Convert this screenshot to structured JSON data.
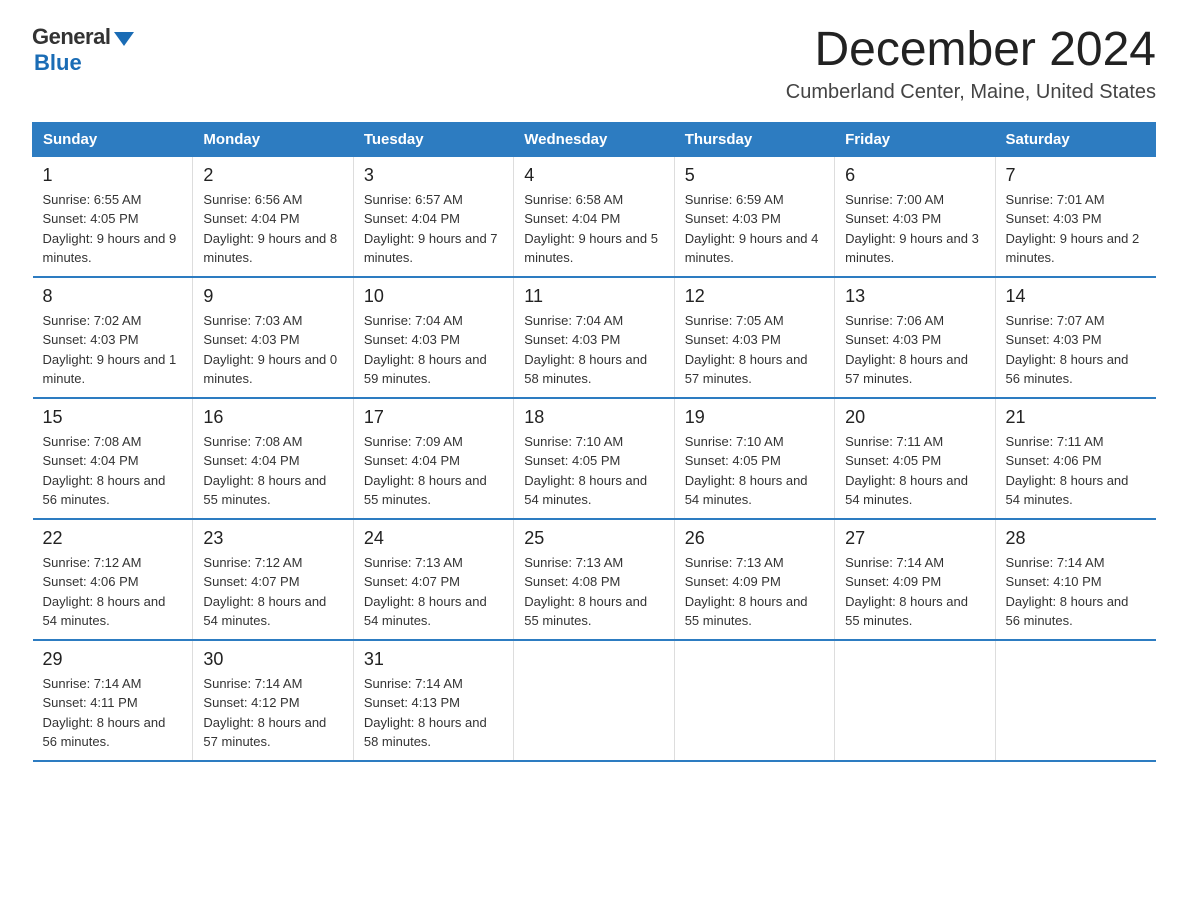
{
  "logo": {
    "general": "General",
    "blue": "Blue"
  },
  "header": {
    "month": "December 2024",
    "location": "Cumberland Center, Maine, United States"
  },
  "days_of_week": [
    "Sunday",
    "Monday",
    "Tuesday",
    "Wednesday",
    "Thursday",
    "Friday",
    "Saturday"
  ],
  "weeks": [
    [
      {
        "day": "1",
        "sunrise": "6:55 AM",
        "sunset": "4:05 PM",
        "daylight": "9 hours and 9 minutes."
      },
      {
        "day": "2",
        "sunrise": "6:56 AM",
        "sunset": "4:04 PM",
        "daylight": "9 hours and 8 minutes."
      },
      {
        "day": "3",
        "sunrise": "6:57 AM",
        "sunset": "4:04 PM",
        "daylight": "9 hours and 7 minutes."
      },
      {
        "day": "4",
        "sunrise": "6:58 AM",
        "sunset": "4:04 PM",
        "daylight": "9 hours and 5 minutes."
      },
      {
        "day": "5",
        "sunrise": "6:59 AM",
        "sunset": "4:03 PM",
        "daylight": "9 hours and 4 minutes."
      },
      {
        "day": "6",
        "sunrise": "7:00 AM",
        "sunset": "4:03 PM",
        "daylight": "9 hours and 3 minutes."
      },
      {
        "day": "7",
        "sunrise": "7:01 AM",
        "sunset": "4:03 PM",
        "daylight": "9 hours and 2 minutes."
      }
    ],
    [
      {
        "day": "8",
        "sunrise": "7:02 AM",
        "sunset": "4:03 PM",
        "daylight": "9 hours and 1 minute."
      },
      {
        "day": "9",
        "sunrise": "7:03 AM",
        "sunset": "4:03 PM",
        "daylight": "9 hours and 0 minutes."
      },
      {
        "day": "10",
        "sunrise": "7:04 AM",
        "sunset": "4:03 PM",
        "daylight": "8 hours and 59 minutes."
      },
      {
        "day": "11",
        "sunrise": "7:04 AM",
        "sunset": "4:03 PM",
        "daylight": "8 hours and 58 minutes."
      },
      {
        "day": "12",
        "sunrise": "7:05 AM",
        "sunset": "4:03 PM",
        "daylight": "8 hours and 57 minutes."
      },
      {
        "day": "13",
        "sunrise": "7:06 AM",
        "sunset": "4:03 PM",
        "daylight": "8 hours and 57 minutes."
      },
      {
        "day": "14",
        "sunrise": "7:07 AM",
        "sunset": "4:03 PM",
        "daylight": "8 hours and 56 minutes."
      }
    ],
    [
      {
        "day": "15",
        "sunrise": "7:08 AM",
        "sunset": "4:04 PM",
        "daylight": "8 hours and 56 minutes."
      },
      {
        "day": "16",
        "sunrise": "7:08 AM",
        "sunset": "4:04 PM",
        "daylight": "8 hours and 55 minutes."
      },
      {
        "day": "17",
        "sunrise": "7:09 AM",
        "sunset": "4:04 PM",
        "daylight": "8 hours and 55 minutes."
      },
      {
        "day": "18",
        "sunrise": "7:10 AM",
        "sunset": "4:05 PM",
        "daylight": "8 hours and 54 minutes."
      },
      {
        "day": "19",
        "sunrise": "7:10 AM",
        "sunset": "4:05 PM",
        "daylight": "8 hours and 54 minutes."
      },
      {
        "day": "20",
        "sunrise": "7:11 AM",
        "sunset": "4:05 PM",
        "daylight": "8 hours and 54 minutes."
      },
      {
        "day": "21",
        "sunrise": "7:11 AM",
        "sunset": "4:06 PM",
        "daylight": "8 hours and 54 minutes."
      }
    ],
    [
      {
        "day": "22",
        "sunrise": "7:12 AM",
        "sunset": "4:06 PM",
        "daylight": "8 hours and 54 minutes."
      },
      {
        "day": "23",
        "sunrise": "7:12 AM",
        "sunset": "4:07 PM",
        "daylight": "8 hours and 54 minutes."
      },
      {
        "day": "24",
        "sunrise": "7:13 AM",
        "sunset": "4:07 PM",
        "daylight": "8 hours and 54 minutes."
      },
      {
        "day": "25",
        "sunrise": "7:13 AM",
        "sunset": "4:08 PM",
        "daylight": "8 hours and 55 minutes."
      },
      {
        "day": "26",
        "sunrise": "7:13 AM",
        "sunset": "4:09 PM",
        "daylight": "8 hours and 55 minutes."
      },
      {
        "day": "27",
        "sunrise": "7:14 AM",
        "sunset": "4:09 PM",
        "daylight": "8 hours and 55 minutes."
      },
      {
        "day": "28",
        "sunrise": "7:14 AM",
        "sunset": "4:10 PM",
        "daylight": "8 hours and 56 minutes."
      }
    ],
    [
      {
        "day": "29",
        "sunrise": "7:14 AM",
        "sunset": "4:11 PM",
        "daylight": "8 hours and 56 minutes."
      },
      {
        "day": "30",
        "sunrise": "7:14 AM",
        "sunset": "4:12 PM",
        "daylight": "8 hours and 57 minutes."
      },
      {
        "day": "31",
        "sunrise": "7:14 AM",
        "sunset": "4:13 PM",
        "daylight": "8 hours and 58 minutes."
      },
      null,
      null,
      null,
      null
    ]
  ],
  "labels": {
    "sunrise": "Sunrise:",
    "sunset": "Sunset:",
    "daylight": "Daylight:"
  }
}
